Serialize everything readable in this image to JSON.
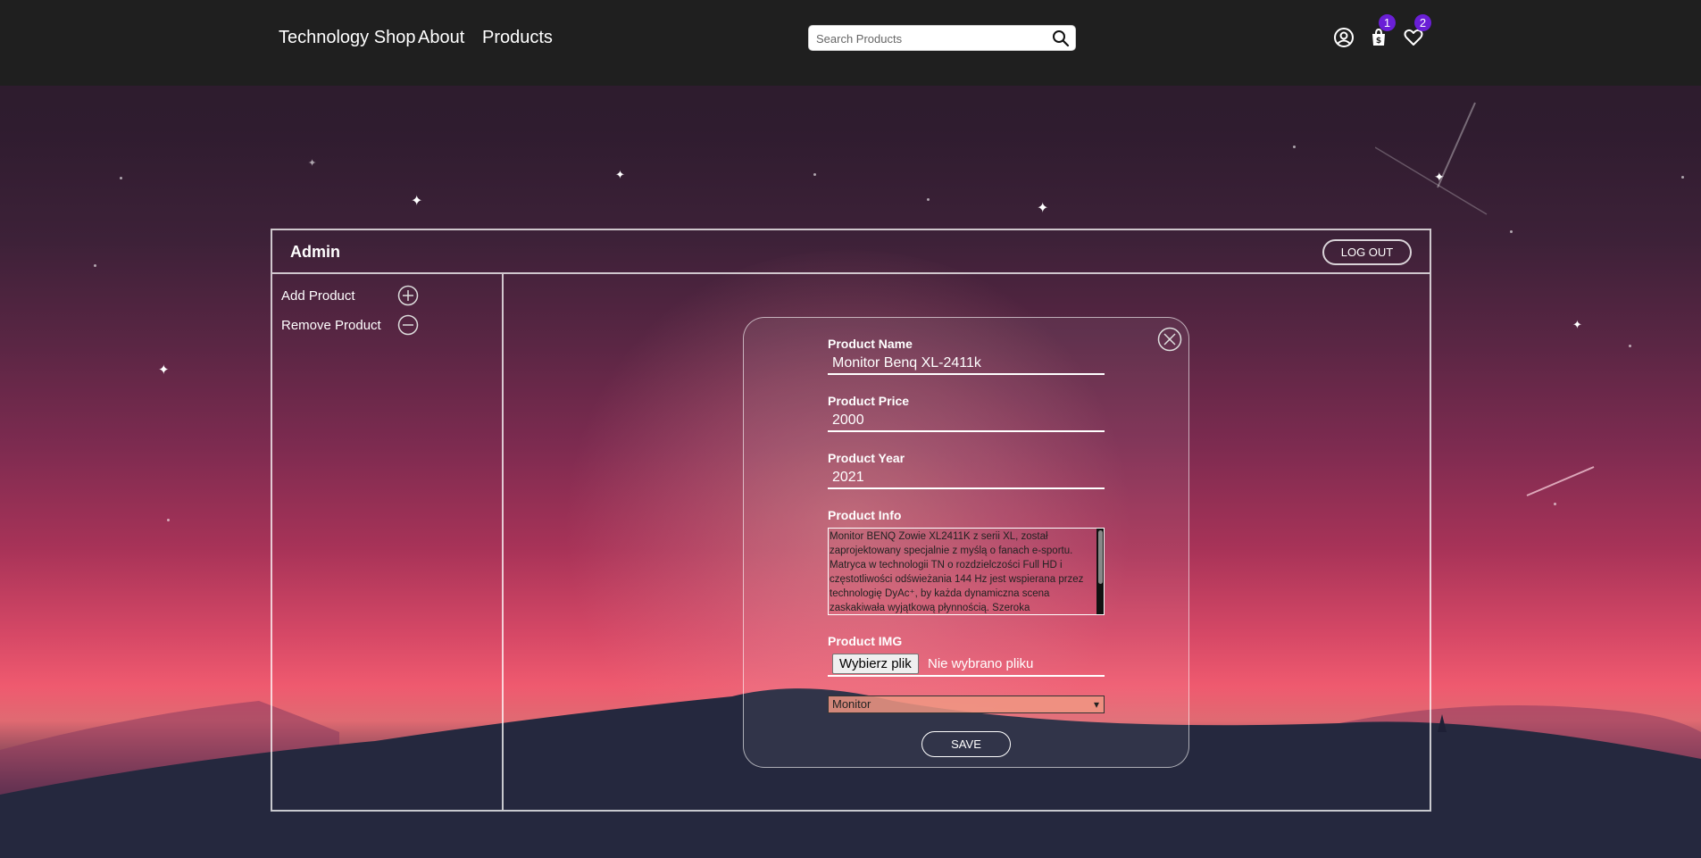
{
  "navbar": {
    "brand": "Technology Shop",
    "links": [
      "About",
      "Products"
    ],
    "search_placeholder": "Search Products",
    "cart_count": "1",
    "wishlist_count": "2",
    "accent_color": "#6a1fd6"
  },
  "admin": {
    "title": "Admin",
    "logout_label": "LOG OUT",
    "sidebar": [
      {
        "label": "Add Product",
        "icon": "plus-circle-icon"
      },
      {
        "label": "Remove Product",
        "icon": "minus-circle-icon"
      }
    ]
  },
  "form": {
    "name_label": "Product Name",
    "name_value": "Monitor Benq XL-2411k",
    "price_label": "Product Price",
    "price_value": "2000",
    "year_label": "Product Year",
    "year_value": "2021",
    "info_label": "Product Info",
    "info_value": "Monitor BENQ Zowie XL2411K z serii XL, został zaprojektowany specjalnie z myślą o fanach e-sportu. Matryca w technologii TN o rozdzielczości Full HD i częstotliwości odświeżania 144 Hz jest wspierana przez technologię DyAc⁺, by każda dynamiczna scena zaskakiwała wyjątkową płynnością. Szeroka",
    "img_label": "Product IMG",
    "file_button": "Wybierz plik",
    "file_status": "Nie wybrano pliku",
    "category_selected": "Monitor",
    "save_label": "SAVE"
  }
}
